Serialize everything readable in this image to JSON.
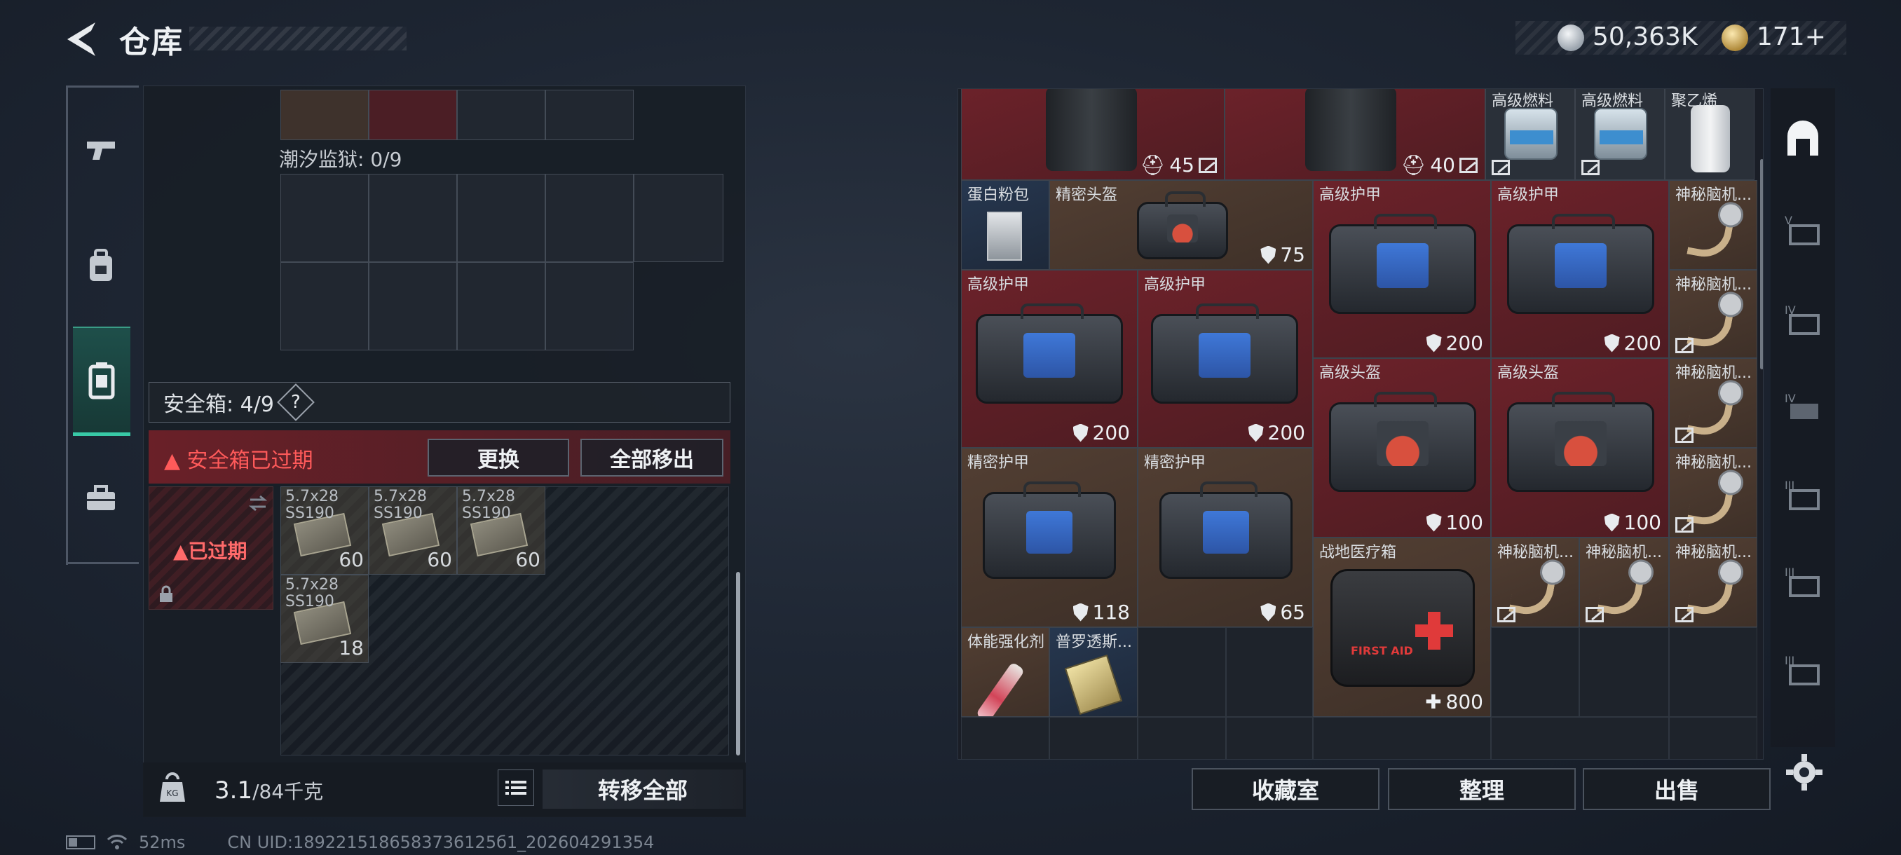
{
  "header": {
    "title": "仓库",
    "currency_primary": "50,363K",
    "currency_secondary": "171+"
  },
  "left_panel": {
    "prison_label": "潮汐监狱: 0/9",
    "safe_label": "安全箱: 4/9",
    "help": "?",
    "expired_notice": "安全箱已过期",
    "btn_replace": "更换",
    "btn_move_all": "全部移出",
    "safe_box_tag": "已过期",
    "ammo": [
      {
        "name": "5.7x28\nSS190",
        "count": "60"
      },
      {
        "name": "5.7x28\nSS190",
        "count": "60"
      },
      {
        "name": "5.7x28\nSS190",
        "count": "60"
      },
      {
        "name": "5.7x28\nSS190",
        "count": "18"
      }
    ],
    "weight": "3.1",
    "weight_cap": "/84千克",
    "transfer_all": "转移全部"
  },
  "stash": {
    "top_row": {
      "armor1_val": "45",
      "armor2_val": "40",
      "fuel1": "高级燃料",
      "fuel2": "高级燃料",
      "poly": "聚乙烯"
    },
    "protein": "蛋白粉包",
    "precise_helmet": {
      "name": "精密头盔",
      "val": "75"
    },
    "adv_armor_a": {
      "name": "高级护甲",
      "val": "200"
    },
    "adv_armor_b": {
      "name": "高级护甲",
      "val": "200"
    },
    "adv_armor_c": {
      "name": "高级护甲",
      "val": "200"
    },
    "adv_armor_d": {
      "name": "高级护甲",
      "val": "200"
    },
    "adv_helmet_a": {
      "name": "高级头盔",
      "val": "100"
    },
    "adv_helmet_b": {
      "name": "高级头盔",
      "val": "100"
    },
    "precise_armor_a": {
      "name": "精密护甲",
      "val": "118"
    },
    "precise_armor_b": {
      "name": "精密护甲",
      "val": "65"
    },
    "medkit": {
      "name": "战地医疗箱",
      "val": "800"
    },
    "mystery": "神秘脑机...",
    "stim": "体能强化剂",
    "pro": "普罗透斯..."
  },
  "bottom_buttons": {
    "collection": "收藏室",
    "organize": "整理",
    "sell": "出售"
  },
  "status": {
    "ping": "52ms",
    "uid": "CN UID:1892215186583736125б1_202604291354"
  },
  "colors": {
    "accent_teal": "#38c9a6",
    "alert_red": "#ff5a5a",
    "cell_red": "#70222a",
    "cell_brown": "#584234"
  },
  "icons": [
    "back-arrow-icon",
    "silver-coin-icon",
    "gold-coin-icon",
    "pistol-icon",
    "backpack-icon",
    "safe-case-icon",
    "toolbox-icon",
    "home-icon",
    "settings-gear-icon",
    "weight-icon",
    "list-icon",
    "shield-icon",
    "no-favorite-icon",
    "wifi-icon",
    "battery-icon"
  ]
}
